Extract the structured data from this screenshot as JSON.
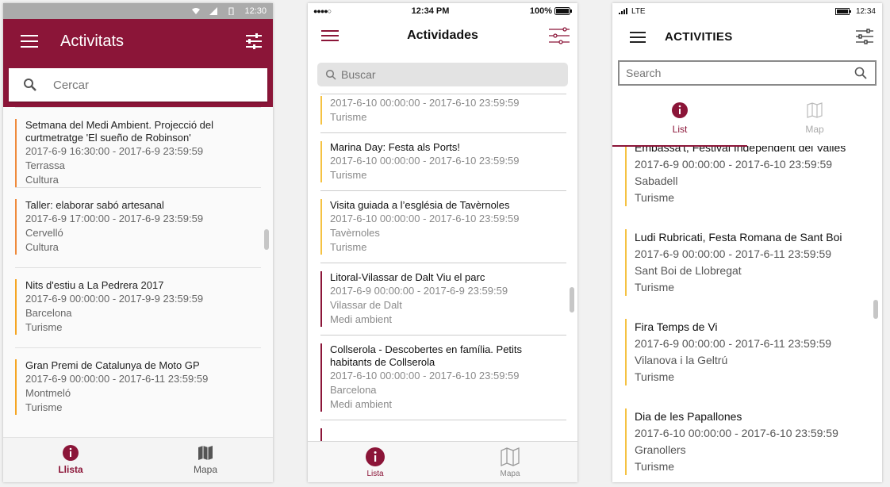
{
  "android": {
    "status_time": "12:30",
    "title": "Activitats",
    "search_placeholder": "Cercar",
    "items": [
      {
        "title": "Setmana del Medi Ambient. Projecció del curtmetratge 'El sueño de Robinson'",
        "date": "2017-6-9 16:30:00 - 2017-6-9 23:59:59",
        "place": "Terrassa",
        "category": "Cultura"
      },
      {
        "title": "Taller: elaborar sabó artesanal",
        "date": "2017-6-9 17:00:00 - 2017-6-9 23:59:59",
        "place": "Cervelló",
        "category": "Cultura"
      },
      {
        "title": "Nits d'estiu a La Pedrera 2017",
        "date": "2017-6-9 00:00:00 - 2017-9-9 23:59:59",
        "place": "Barcelona",
        "category": "Turisme"
      },
      {
        "title": "Gran Premi de Catalunya de Moto GP",
        "date": "2017-6-9 00:00:00 - 2017-6-11 23:59:59",
        "place": "Montmeló",
        "category": "Turisme"
      }
    ],
    "tabs": [
      "Llista",
      "Mapa"
    ]
  },
  "ios": {
    "status_carrier": "●●●●○",
    "status_time": "12:34 PM",
    "status_battery": "100%",
    "title": "Actividades",
    "search_placeholder": "Buscar",
    "items": [
      {
        "title": "",
        "date": "2017-6-10 00:00:00 - 2017-6-10 23:59:59",
        "place": "",
        "category": "Turisme"
      },
      {
        "title": "Marina Day: Festa als Ports!",
        "date": "2017-6-10 00:00:00 - 2017-6-10 23:59:59",
        "place": "",
        "category": "Turisme"
      },
      {
        "title": "Visita guiada a l’església de Tavèrnoles",
        "date": "2017-6-10 00:00:00 - 2017-6-10 23:59:59",
        "place": "Tavèrnoles",
        "category": "Turisme"
      },
      {
        "title": "Litoral-Vilassar de Dalt Viu el parc",
        "date": "2017-6-9 00:00:00 - 2017-6-9 23:59:59",
        "place": "Vilassar de Dalt",
        "category": "Medi ambient"
      },
      {
        "title": "Collserola - Descobertes en família. Petits habitants de Collserola",
        "date": "2017-6-10 00:00:00 - 2017-6-10 23:59:59",
        "place": "Barcelona",
        "category": "Medi ambient"
      }
    ],
    "tabs": [
      "Lista",
      "Mapa"
    ]
  },
  "windows": {
    "status_network": "LTE",
    "status_time": "12:34",
    "title": "ACTIVITIES",
    "search_placeholder": "Search",
    "tabs": [
      "List",
      "Map"
    ],
    "items": [
      {
        "title": "Embassa't, Festival Independent del Vallès",
        "date": "2017-6-9 00:00:00 - 2017-6-10 23:59:59",
        "place": "Sabadell",
        "category": "Turisme"
      },
      {
        "title": "Ludi Rubricati, Festa Romana de Sant Boi",
        "date": "2017-6-9 00:00:00 - 2017-6-11 23:59:59",
        "place": "Sant Boi de Llobregat",
        "category": "Turisme"
      },
      {
        "title": "Fira Temps de Vi",
        "date": "2017-6-9 00:00:00 - 2017-6-11 23:59:59",
        "place": "Vilanova i la Geltrú",
        "category": "Turisme"
      },
      {
        "title": "Dia de les Papallones",
        "date": "2017-6-10 00:00:00 - 2017-6-10 23:59:59",
        "place": "Granollers",
        "category": "Turisme"
      }
    ]
  },
  "colors": {
    "brand": "#8b1538",
    "accent_yellow": "#f5c242",
    "accent_orange": "#ef8a3c"
  }
}
